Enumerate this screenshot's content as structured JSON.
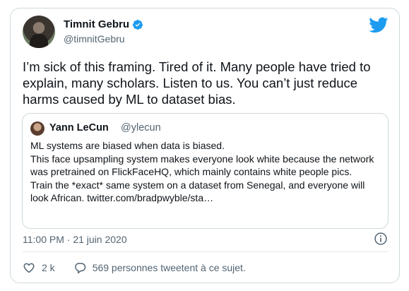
{
  "author": {
    "name": "Timnit Gebru",
    "handle": "@timnitGebru"
  },
  "tweet": {
    "text": "I’m sick of this framing. Tired of it. Many people have tried to explain, many scholars. Listen to us. You can’t just reduce harms caused by ML to dataset bias.",
    "timestamp": "11:00 PM · 21 juin 2020"
  },
  "quoted": {
    "name": "Yann LeCun",
    "handle": "@ylecun",
    "lines": [
      "ML systems are biased when data is biased.",
      "This face upsampling system makes everyone look white because the network was pretrained on FlickFaceHQ, which mainly contains white people pics.",
      "Train the *exact* same system on a dataset from Senegal, and everyone will look African. twitter.com/bradpwyble/sta…"
    ]
  },
  "actions": {
    "likes": "2 k",
    "conversation": "569 personnes tweetent à ce sujet."
  },
  "colors": {
    "twitter_blue": "#1d9bf0",
    "muted": "#536471",
    "border": "#cfd9de"
  },
  "icons": [
    "verified-badge-icon",
    "twitter-bird-icon",
    "info-icon",
    "heart-icon",
    "reply-bubble-icon"
  ]
}
